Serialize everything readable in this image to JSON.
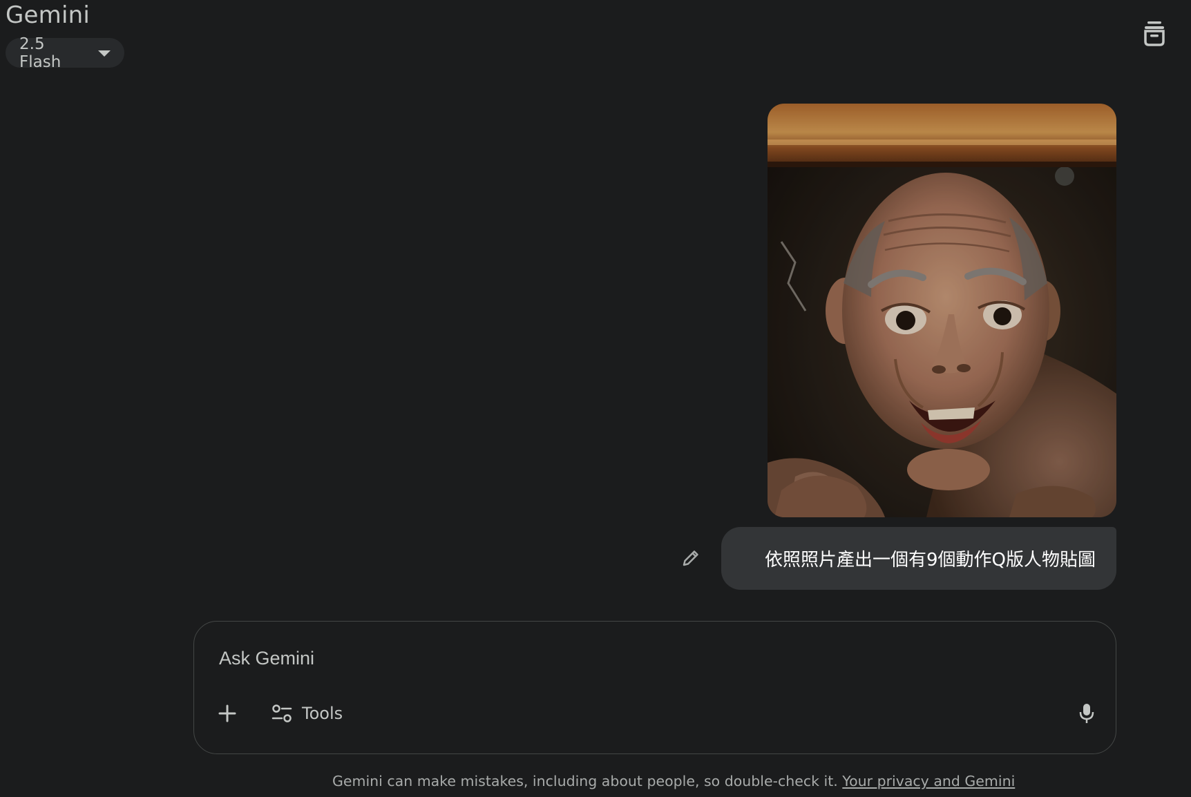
{
  "header": {
    "app_title": "Gemini",
    "model_selector_label": "2.5 Flash",
    "top_right_icon": "temporary-chat-icon"
  },
  "conversation": {
    "user_image_description_icon": "uploaded-photo",
    "user_message": "依照照片產出一個有9個動作Q版人物貼圖",
    "edit_icon": "pencil-icon"
  },
  "composer": {
    "placeholder": "Ask Gemini",
    "value": "",
    "plus_icon": "plus-icon",
    "tools_label": "Tools",
    "tools_icon": "tools-sliders-icon",
    "mic_icon": "microphone-icon"
  },
  "footer": {
    "disclaimer_text": "Gemini can make mistakes, including about people, so double-check it. ",
    "privacy_link": "Your privacy and Gemini"
  },
  "colors": {
    "background": "#1b1c1d",
    "bubble": "#333537",
    "chip": "#282a2c",
    "border": "#444746",
    "text_primary": "#e3e3e3",
    "text_secondary": "#c4c7c5"
  }
}
